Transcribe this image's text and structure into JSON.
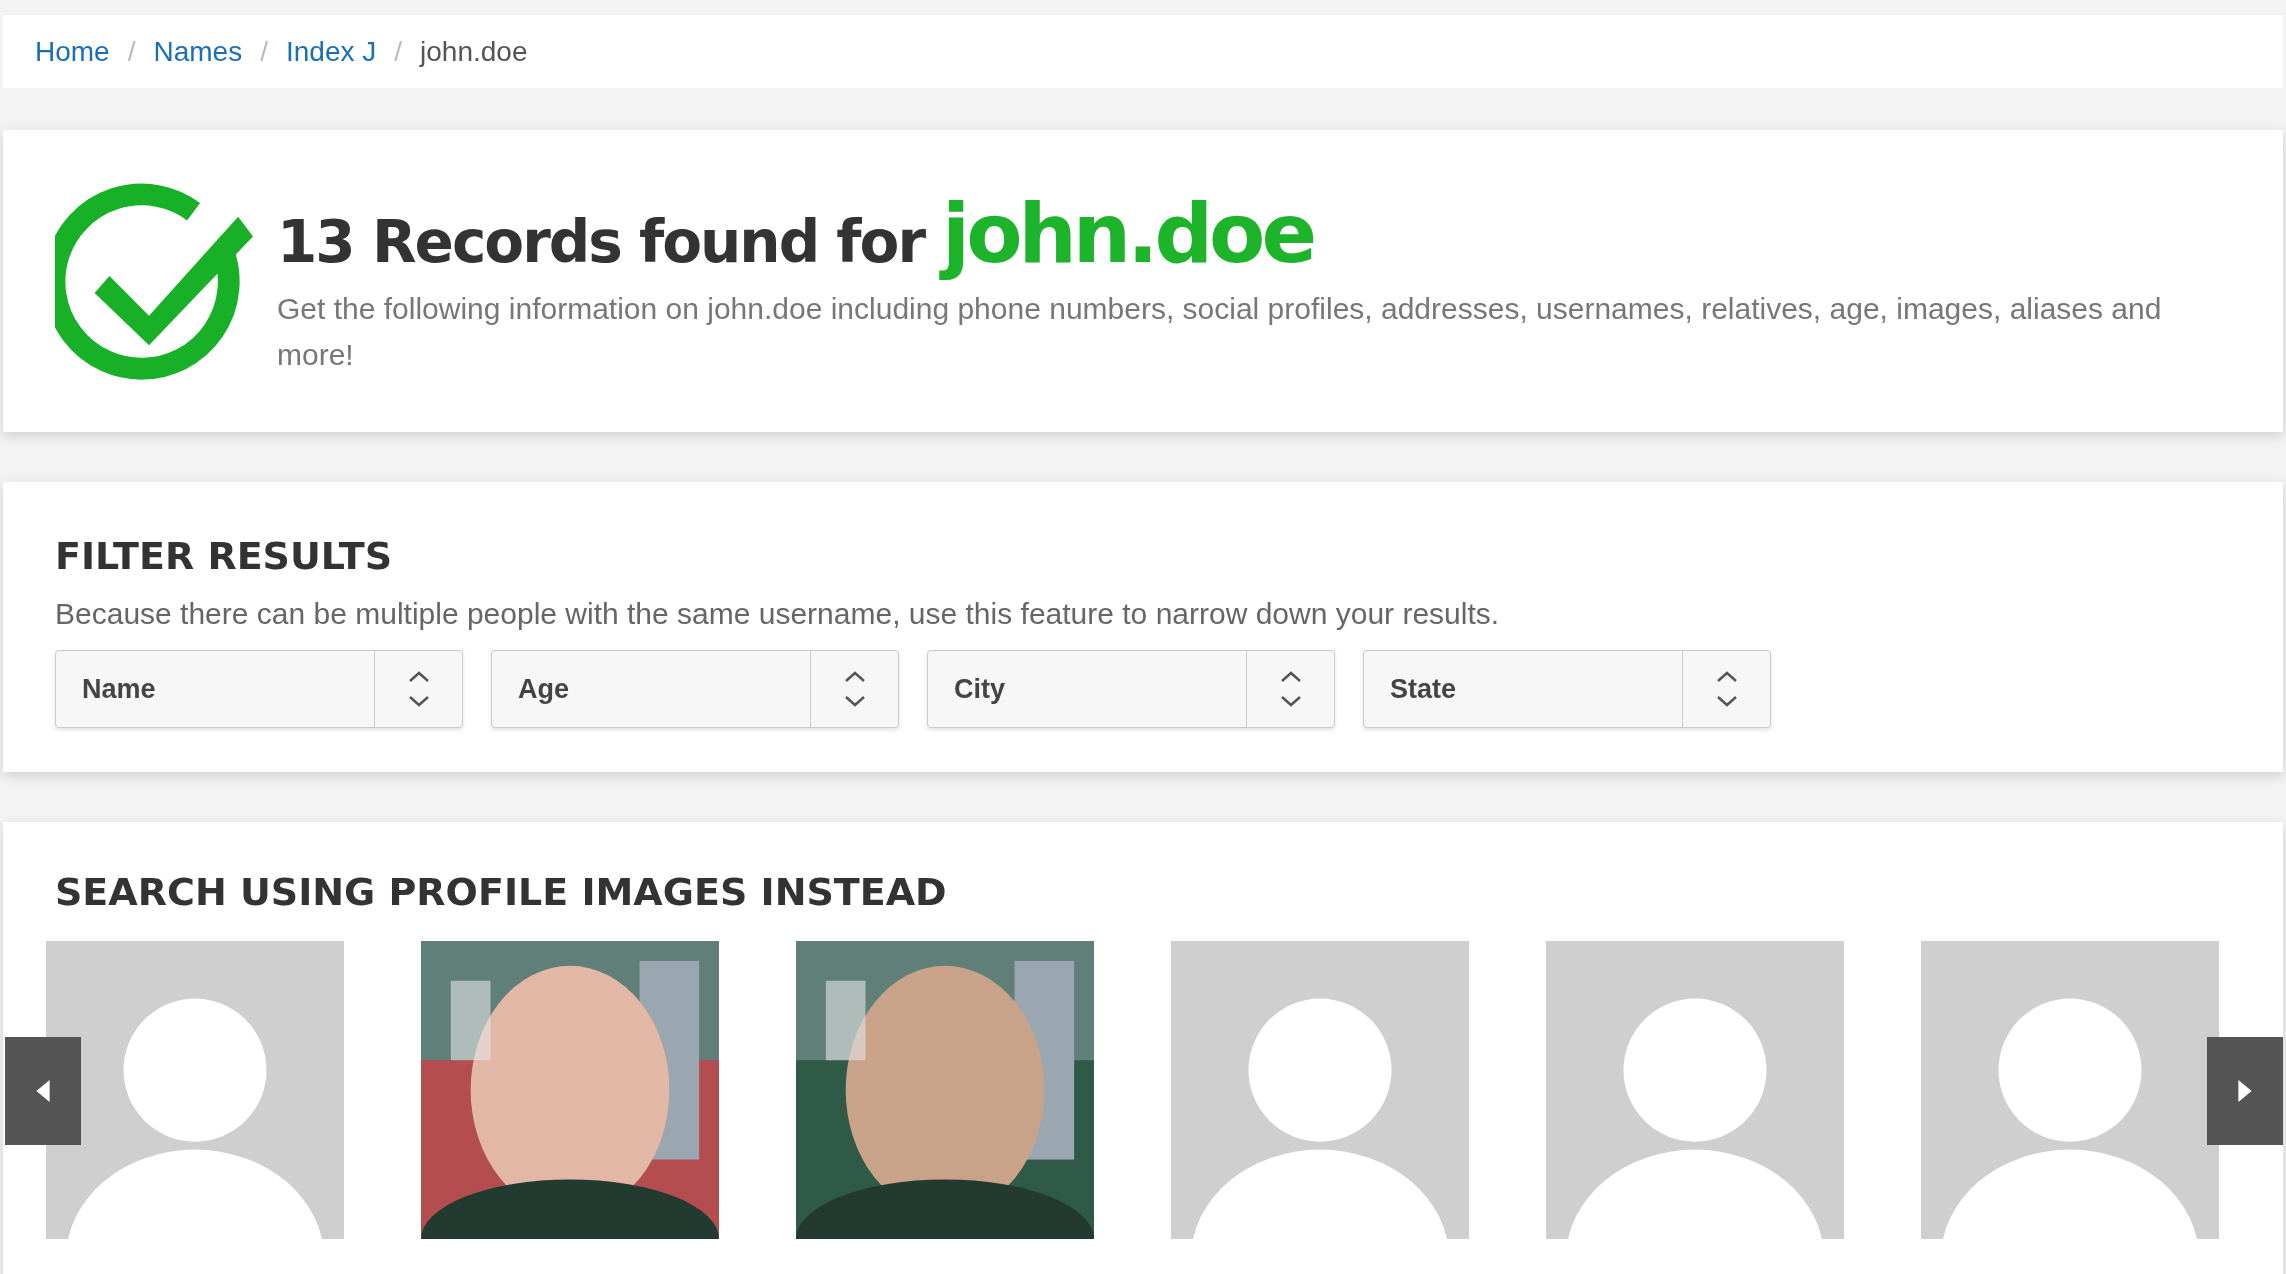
{
  "breadcrumb": [
    {
      "label": "Home",
      "kind": "link"
    },
    {
      "label": "Names",
      "kind": "link",
      "separator": "/"
    },
    {
      "label": "Index J",
      "kind": "link",
      "separator": "/"
    },
    {
      "label": "john.doe",
      "kind": "current",
      "separator": "/"
    }
  ],
  "header": {
    "count_text": "13 Records found for",
    "query": "john.doe",
    "description": "Get the following information on john.doe including phone numbers, social profiles, addresses, usernames, relatives, age, images, aliases and more!"
  },
  "filter": {
    "title": "FILTER RESULTS",
    "description": "Because there can be multiple people with the same username, use this feature to narrow down your results.",
    "selects": [
      {
        "label": "Name"
      },
      {
        "label": "Age"
      },
      {
        "label": "City"
      },
      {
        "label": "State"
      }
    ]
  },
  "profiles": {
    "title": "SEARCH USING PROFILE IMAGES INSTEAD",
    "images": [
      {
        "kind": "silhouette"
      },
      {
        "kind": "picture"
      },
      {
        "kind": "picture"
      },
      {
        "kind": "silhouette"
      },
      {
        "kind": "silhouette"
      },
      {
        "kind": "silhouette"
      }
    ]
  }
}
